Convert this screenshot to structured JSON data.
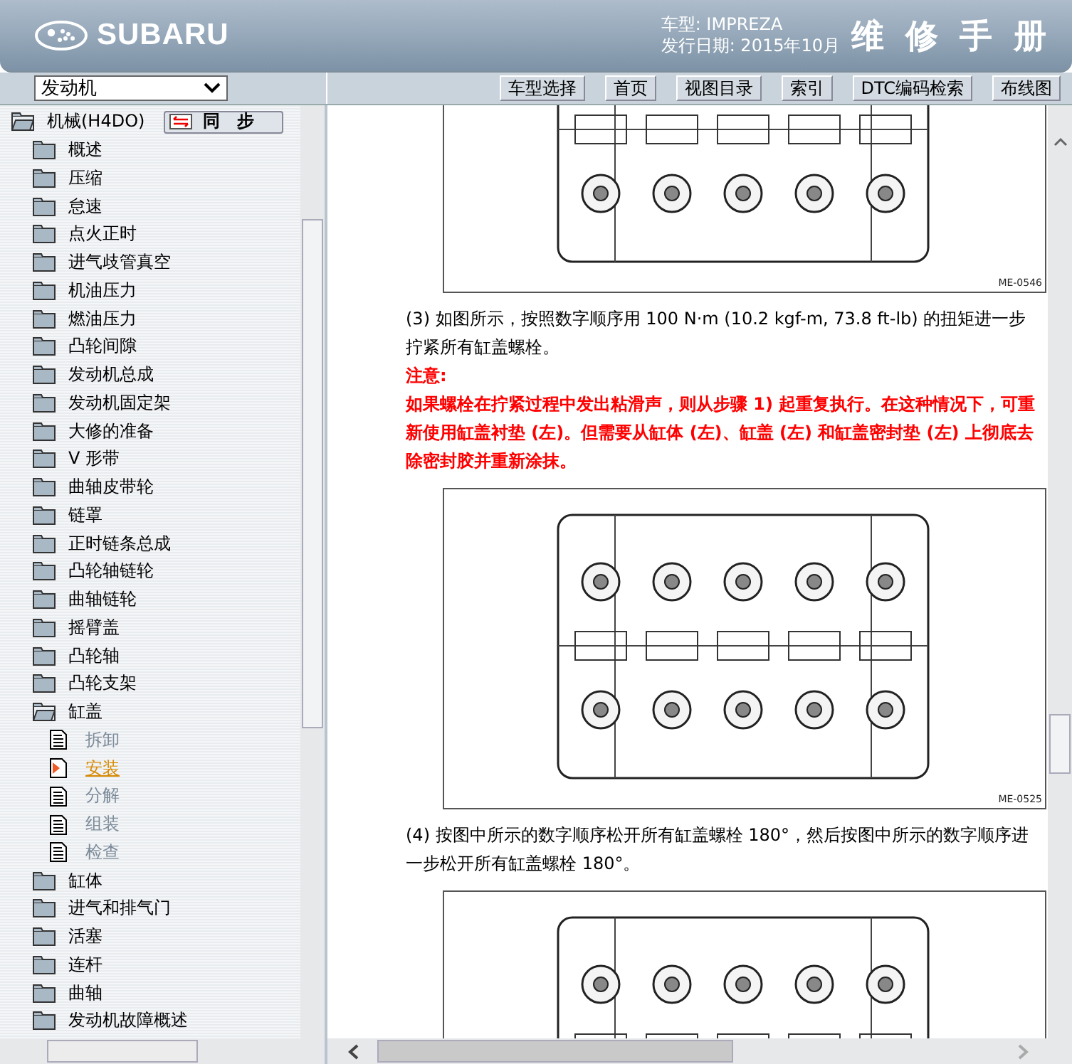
{
  "header": {
    "brand": "SUBARU",
    "model_line": "车型: IMPREZA",
    "date_line": "发行日期: 2015年10月",
    "title": "维修手册"
  },
  "toolbar": {
    "section_select": {
      "value": "发动机"
    },
    "sync_button": "同步",
    "nav_buttons": [
      "车型选择",
      "首页",
      "视图目录",
      "索引",
      "DTC编码检索",
      "布线图"
    ]
  },
  "tree": {
    "label": "机械(H4DO)",
    "expanded": true,
    "children": [
      {
        "label": "概述",
        "expanded": false
      },
      {
        "label": "压缩",
        "expanded": false
      },
      {
        "label": "怠速",
        "expanded": false
      },
      {
        "label": "点火正时",
        "expanded": false
      },
      {
        "label": "进气歧管真空",
        "expanded": false
      },
      {
        "label": "机油压力",
        "expanded": false
      },
      {
        "label": "燃油压力",
        "expanded": false
      },
      {
        "label": "凸轮间隙",
        "expanded": false
      },
      {
        "label": "发动机总成",
        "expanded": false
      },
      {
        "label": "发动机固定架",
        "expanded": false
      },
      {
        "label": "大修的准备",
        "expanded": false
      },
      {
        "label": "V 形带",
        "expanded": false
      },
      {
        "label": "曲轴皮带轮",
        "expanded": false
      },
      {
        "label": "链罩",
        "expanded": false
      },
      {
        "label": "正时链条总成",
        "expanded": false
      },
      {
        "label": "凸轮轴链轮",
        "expanded": false
      },
      {
        "label": "曲轴链轮",
        "expanded": false
      },
      {
        "label": "摇臂盖",
        "expanded": false
      },
      {
        "label": "凸轮轴",
        "expanded": false
      },
      {
        "label": "凸轮支架",
        "expanded": false
      },
      {
        "label": "缸盖",
        "expanded": true,
        "children": [
          {
            "label": "拆卸",
            "selected": false
          },
          {
            "label": "安装",
            "selected": true
          },
          {
            "label": "分解",
            "selected": false
          },
          {
            "label": "组装",
            "selected": false
          },
          {
            "label": "检查",
            "selected": false
          }
        ]
      },
      {
        "label": "缸体",
        "expanded": false
      },
      {
        "label": "进气和排气门",
        "expanded": false
      },
      {
        "label": "活塞",
        "expanded": false
      },
      {
        "label": "连杆",
        "expanded": false
      },
      {
        "label": "曲轴",
        "expanded": false
      },
      {
        "label": "发动机故障概述",
        "expanded": false
      }
    ]
  },
  "content": [
    {
      "kind": "figure",
      "code": "ME-0546"
    },
    {
      "kind": "text",
      "text": "(3) 如图所示，按照数字顺序用 100 N·m (10.2 kgf-m, 73.8 ft-lb) 的扭矩进一步拧紧所有缸盖螺栓。"
    },
    {
      "kind": "note_heading",
      "text": "注意:"
    },
    {
      "kind": "note",
      "text": "如果螺栓在拧紧过程中发出粘滑声，则从步骤 1) 起重复执行。在这种情况下，可重新使用缸盖衬垫 (左)。但需要从缸体 (左)、缸盖 (左) 和缸盖密封垫 (左) 上彻底去除密封胶并重新涂抹。"
    },
    {
      "kind": "figure",
      "code": "ME-0525"
    },
    {
      "kind": "text",
      "text": "(4) 按图中所示的数字顺序松开所有缸盖螺栓 180°，然后按图中所示的数字顺序进一步松开所有缸盖螺栓 180°。"
    },
    {
      "kind": "figure"
    }
  ]
}
